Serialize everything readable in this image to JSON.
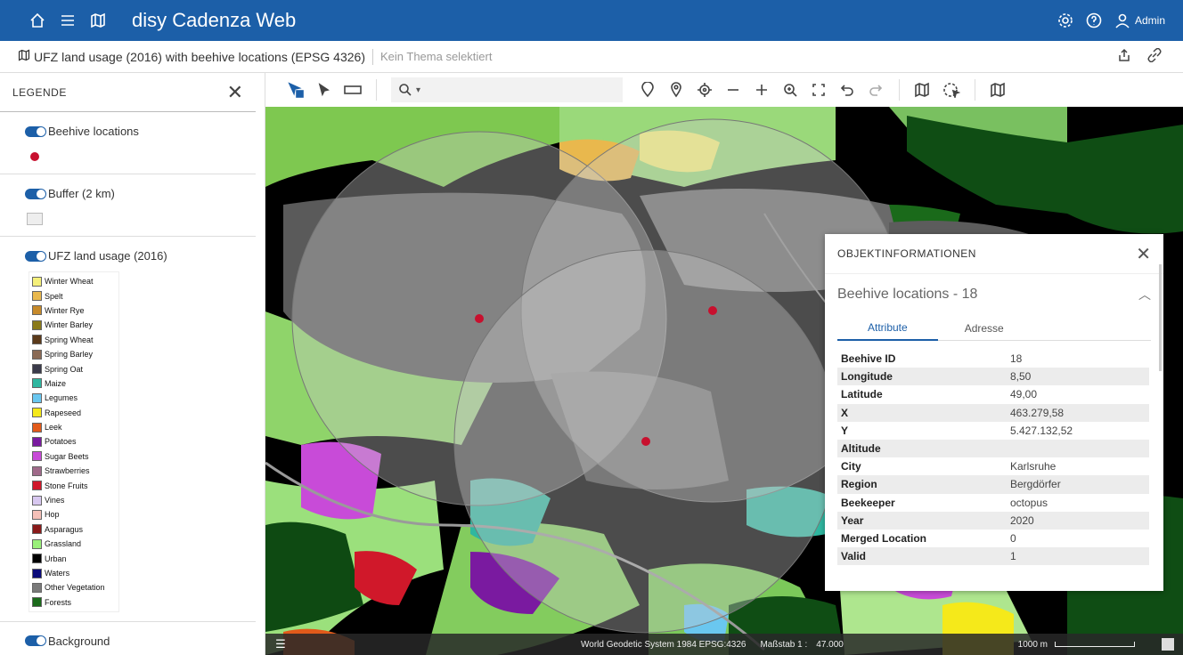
{
  "app": {
    "title": "disy Cadenza Web",
    "user": "Admin"
  },
  "theme": {
    "title": "UFZ land usage (2016) with beehive locations (EPSG 4326)",
    "topic": "Kein Thema selektiert"
  },
  "legend": {
    "title": "LEGENDE",
    "layers": {
      "beehive": "Beehive locations",
      "buffer": "Buffer (2 km)",
      "landuse": "UFZ land usage (2016)",
      "background": "Background"
    },
    "classes": [
      {
        "label": "Winter Wheat",
        "color": "#f5f07a"
      },
      {
        "label": "Spelt",
        "color": "#e9b84d"
      },
      {
        "label": "Winter Rye",
        "color": "#c78a2a"
      },
      {
        "label": "Winter Barley",
        "color": "#8a7a1a"
      },
      {
        "label": "Spring Wheat",
        "color": "#5b3a1a"
      },
      {
        "label": "Spring Barley",
        "color": "#8a6a55"
      },
      {
        "label": "Spring Oat",
        "color": "#3a3a4a"
      },
      {
        "label": "Maize",
        "color": "#2fb7a0"
      },
      {
        "label": "Legumes",
        "color": "#6ac7f0"
      },
      {
        "label": "Rapeseed",
        "color": "#f5e91a"
      },
      {
        "label": "Leek",
        "color": "#e25a1a"
      },
      {
        "label": "Potatoes",
        "color": "#7a1aa0"
      },
      {
        "label": "Sugar Beets",
        "color": "#c84bd8"
      },
      {
        "label": "Strawberries",
        "color": "#a06a8a"
      },
      {
        "label": "Stone Fruits",
        "color": "#d0182a"
      },
      {
        "label": "Vines",
        "color": "#d8c8f0"
      },
      {
        "label": "Hop",
        "color": "#f5c0b8"
      },
      {
        "label": "Asparagus",
        "color": "#8a1a1a"
      },
      {
        "label": "Grassland",
        "color": "#9af07a"
      },
      {
        "label": "Urban",
        "color": "#000000"
      },
      {
        "label": "Waters",
        "color": "#0a0a7a"
      },
      {
        "label": "Other Vegetation",
        "color": "#7a7a7a"
      },
      {
        "label": "Forests",
        "color": "#1a6a1a"
      }
    ]
  },
  "toolbar": {
    "search_icon": "search-icon"
  },
  "status": {
    "crs": "World Geodetic System 1984 EPSG:4326",
    "scale_label": "Maßstab 1 :",
    "scale_value": "47.000",
    "bar_label": "1000 m"
  },
  "info": {
    "title": "OBJEKTINFORMATIONEN",
    "feature": "Beehive locations - 18",
    "tabs": [
      "Attribute",
      "Adresse"
    ],
    "rows": [
      {
        "k": "Beehive ID",
        "v": "18"
      },
      {
        "k": "Longitude",
        "v": "8,50"
      },
      {
        "k": "Latitude",
        "v": "49,00"
      },
      {
        "k": "X",
        "v": "463.279,58"
      },
      {
        "k": "Y",
        "v": "5.427.132,52"
      },
      {
        "k": "Altitude",
        "v": ""
      },
      {
        "k": "City",
        "v": "Karlsruhe"
      },
      {
        "k": "Region",
        "v": "Bergdörfer"
      },
      {
        "k": "Beekeeper",
        "v": "octopus"
      },
      {
        "k": "Year",
        "v": "2020"
      },
      {
        "k": "Merged Location",
        "v": "0"
      },
      {
        "k": "Valid",
        "v": "1"
      }
    ]
  }
}
